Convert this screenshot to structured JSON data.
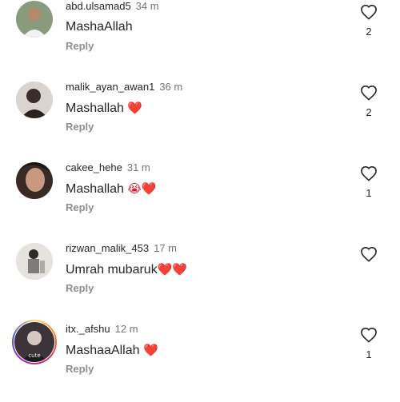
{
  "comments": [
    {
      "username": "abd.ulsamad5",
      "time": "34 m",
      "text": "MashaAllah",
      "emoji": "",
      "reply": "Reply",
      "likes": "2",
      "avatar_icon": "avatar-icon",
      "heart_color": "#e0182d"
    },
    {
      "username": "malik_ayan_awan1",
      "time": "36 m",
      "text": "Mashallah ",
      "emoji": "❤️",
      "reply": "Reply",
      "likes": "2",
      "avatar_icon": "avatar-icon"
    },
    {
      "username": "cakee_hehe",
      "time": "31 m",
      "text": "Mashallah ",
      "emoji": "😭❤️",
      "reply": "Reply",
      "likes": "1",
      "avatar_icon": "avatar-icon"
    },
    {
      "username": "rizwan_malik_453",
      "time": "17 m",
      "text": "Umrah mubaruk",
      "emoji": "❤️❤️",
      "reply": "Reply",
      "likes": "",
      "avatar_icon": "avatar-icon"
    },
    {
      "username": "itx._afshu",
      "time": "12 m",
      "text": "MashaaAllah ",
      "emoji": "❤️",
      "reply": "Reply",
      "likes": "1",
      "avatar_icon": "avatar-story-icon"
    }
  ],
  "colors": {
    "text": "#262626",
    "secondary": "#737373",
    "reply": "#8e8e8e",
    "heart": "#e0182d"
  }
}
